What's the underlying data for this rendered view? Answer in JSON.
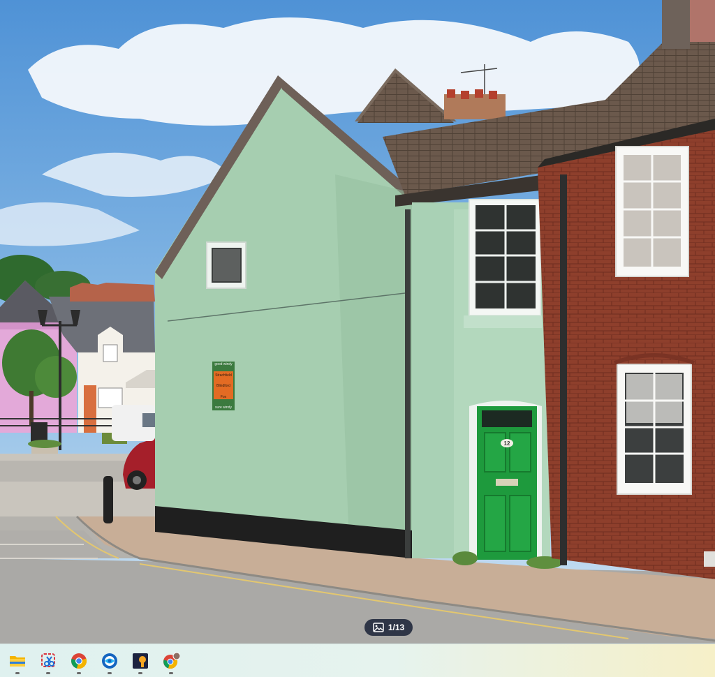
{
  "viewer": {
    "photo_alt": "Photo of a pale green end-terrace cottage with a green front door beside a red brick house",
    "counter": "1/13",
    "counter_icon": "image-icon"
  },
  "house_number": "12",
  "sign_lines": [
    "good windy",
    "Strachfield",
    "Blindford",
    "Fox",
    "sure windy"
  ],
  "colors": {
    "sky": "#6fa9df",
    "wall_green": "#a6ceb0",
    "door_green": "#1e9a3d",
    "brick": "#8e3f2c",
    "counter_bg": "#1e263a",
    "taskbar_start": "#dff1ef",
    "taskbar_end": "#f6f0c8"
  },
  "taskbar": {
    "apps": [
      {
        "name": "file-explorer",
        "icon": "folder-icon",
        "running": true
      },
      {
        "name": "snipping-tool",
        "icon": "scissors-icon",
        "running": true
      },
      {
        "name": "chrome",
        "icon": "chrome-icon",
        "running": true
      },
      {
        "name": "browser",
        "icon": "globe-icon",
        "running": true
      },
      {
        "name": "app",
        "icon": "keyhole-icon",
        "running": true
      },
      {
        "name": "chrome-profile",
        "icon": "chrome-profile-icon",
        "running": true
      }
    ]
  }
}
